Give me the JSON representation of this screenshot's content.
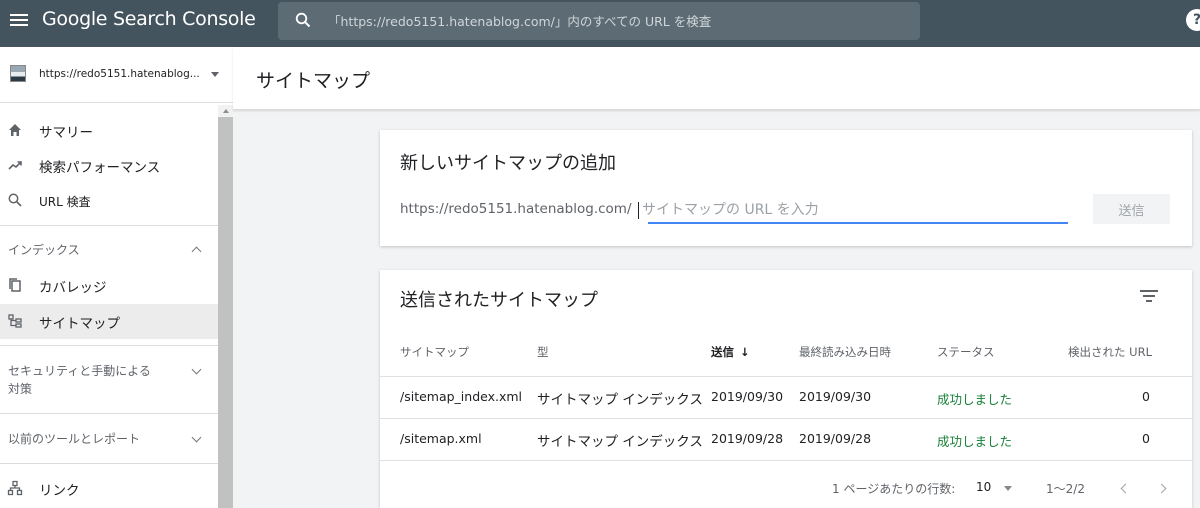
{
  "topbar": {
    "app_title": "Google Search Console",
    "search_placeholder": "「https://redo5151.hatenablog.com/」内のすべての URL を検査",
    "help_label": "?"
  },
  "sidebar": {
    "property_label": "https://redo5151.hatenablog...",
    "items_top": [
      {
        "label": "サマリー",
        "icon": "home-icon"
      },
      {
        "label": "検索パフォーマンス",
        "icon": "trending-up-icon"
      },
      {
        "label": "URL 検査",
        "icon": "search-icon"
      }
    ],
    "section_index": {
      "label": "インデックス",
      "items": [
        {
          "label": "カバレッジ",
          "icon": "copy-icon"
        },
        {
          "label": "サイトマップ",
          "icon": "sitemap-icon"
        }
      ]
    },
    "section_security": {
      "label_line1": "セキュリティと手動による",
      "label_line2": "対策"
    },
    "section_legacy": {
      "label": "以前のツールとレポート"
    },
    "links_item": {
      "label": "リンク",
      "icon": "links-icon"
    }
  },
  "page": {
    "title": "サイトマップ"
  },
  "add_card": {
    "title": "新しいサイトマップの追加",
    "prefix": "https://redo5151.hatenablog.com/",
    "input_placeholder": "サイトマップの URL を入力",
    "submit_label": "送信"
  },
  "submitted_card": {
    "title": "送信されたサイトマップ",
    "columns": [
      "サイトマップ",
      "型",
      "送信",
      "最終読み込み日時",
      "ステータス",
      "検出された URL"
    ],
    "sort_arrow": "↓",
    "rows": [
      [
        "/sitemap_index.xml",
        "サイトマップ インデックス",
        "2019/09/30",
        "2019/09/30",
        "成功しました",
        "0"
      ],
      [
        "/sitemap.xml",
        "サイトマップ インデックス",
        "2019/09/28",
        "2019/09/28",
        "成功しました",
        "0"
      ]
    ],
    "pager": {
      "rows_label": "1 ページあたりの行数:",
      "rows_value": "10",
      "range": "1〜2/2"
    }
  },
  "colors": {
    "topbar": "#44545f",
    "accent": "#4285f4",
    "success": "#188038"
  }
}
